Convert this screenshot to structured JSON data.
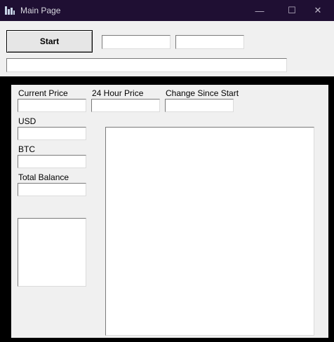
{
  "window": {
    "title": "Main Page",
    "minimize_glyph": "—",
    "maximize_glyph": "☐",
    "close_glyph": "✕"
  },
  "toolbar": {
    "start_label": "Start",
    "field1_value": "",
    "field2_value": "",
    "status_value": ""
  },
  "panel": {
    "current_price_label": "Current Price",
    "hour24_price_label": "24 Hour Price",
    "change_since_start_label": "Change Since Start",
    "usd_label": "USD",
    "btc_label": "BTC",
    "total_balance_label": "Total Balance",
    "current_price_value": "",
    "hour24_price_value": "",
    "change_since_start_value": "",
    "usd_value": "",
    "btc_value": "",
    "total_balance_value": ""
  },
  "colors": {
    "titlebar": "#1f0f33",
    "panel_border": "#000000",
    "background": "#f0f0f0"
  }
}
